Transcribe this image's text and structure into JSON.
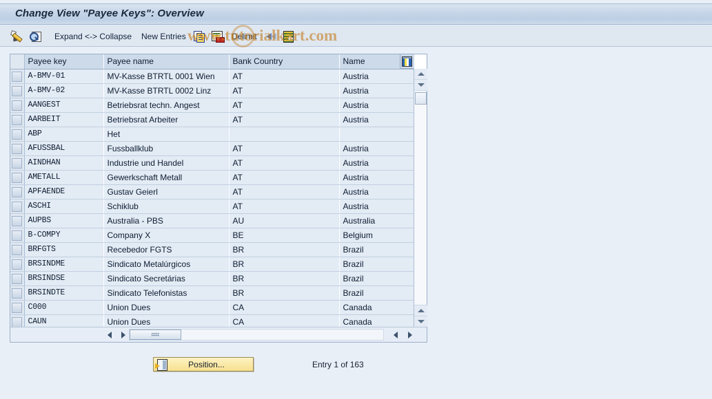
{
  "window": {
    "title": "Change View \"Payee Keys\": Overview"
  },
  "toolbar": {
    "edit_icon": "pencil-edit-icon",
    "display_icon": "magnifier-display-icon",
    "expand_collapse_label": "Expand <-> Collapse",
    "new_entries_label": "New Entries",
    "copy_icon": "copy-icon",
    "delete_row_icon": "delete-row-icon",
    "delimit_label": "Delimit",
    "delimit_icon": "delimit-arrows-icon",
    "select_table_icon": "table-select-icon"
  },
  "watermark": {
    "text": "www.tutorialkart.com"
  },
  "table": {
    "columns": [
      "Payee key",
      "Payee name",
      "Bank Country",
      "Name"
    ],
    "column_config_icon": "column-config-icon",
    "rows": [
      {
        "key": "A-BMV-01",
        "name": "MV-Kasse  BTRTL 0001 Wien",
        "country": "AT",
        "country_name": "Austria"
      },
      {
        "key": "A-BMV-02",
        "name": "MV-Kasse  BTRTL 0002 Linz",
        "country": "AT",
        "country_name": "Austria"
      },
      {
        "key": "AANGEST",
        "name": "Betriebsrat techn. Angest",
        "country": "AT",
        "country_name": "Austria"
      },
      {
        "key": "AARBEIT",
        "name": "Betriebsrat Arbeiter",
        "country": "AT",
        "country_name": "Austria"
      },
      {
        "key": "ABP",
        "name": "Het",
        "country": "",
        "country_name": ""
      },
      {
        "key": "AFUSSBAL",
        "name": "Fussballklub",
        "country": "AT",
        "country_name": "Austria"
      },
      {
        "key": "AINDHAN",
        "name": "Industrie und Handel",
        "country": "AT",
        "country_name": "Austria"
      },
      {
        "key": "AMETALL",
        "name": "Gewerkschaft Metall",
        "country": "AT",
        "country_name": "Austria"
      },
      {
        "key": "APFAENDE",
        "name": "Gustav Geierl",
        "country": "AT",
        "country_name": "Austria"
      },
      {
        "key": "ASCHI",
        "name": "Schiklub",
        "country": "AT",
        "country_name": "Austria"
      },
      {
        "key": "AUPBS",
        "name": "Australia - PBS",
        "country": "AU",
        "country_name": "Australia"
      },
      {
        "key": "B-COMPY",
        "name": "Company X",
        "country": "BE",
        "country_name": "Belgium"
      },
      {
        "key": "BRFGTS",
        "name": "Recebedor FGTS",
        "country": "BR",
        "country_name": "Brazil"
      },
      {
        "key": "BRSINDME",
        "name": "Sindicato Metalúrgicos",
        "country": "BR",
        "country_name": "Brazil"
      },
      {
        "key": "BRSINDSE",
        "name": "Sindicato Secretárias",
        "country": "BR",
        "country_name": "Brazil"
      },
      {
        "key": "BRSINDTE",
        "name": "Sindicato Telefonistas",
        "country": "BR",
        "country_name": "Brazil"
      },
      {
        "key": "C000",
        "name": "Union Dues",
        "country": "CA",
        "country_name": "Canada"
      },
      {
        "key": "CAUN",
        "name": "Union Dues",
        "country": "CA",
        "country_name": "Canada"
      }
    ]
  },
  "footer": {
    "position_label": "Position...",
    "position_icon": "position-icon",
    "entry_status": "Entry 1 of 163"
  },
  "colors": {
    "title_bar": "#c6d5e8",
    "toolbar": "#dfe7f1",
    "header_cell": "#ccdaea",
    "row_cell": "#e3ebf5",
    "page_bg": "#e9eff7",
    "button_yellow": "#f7e08f",
    "watermark": "#c47e1e"
  }
}
